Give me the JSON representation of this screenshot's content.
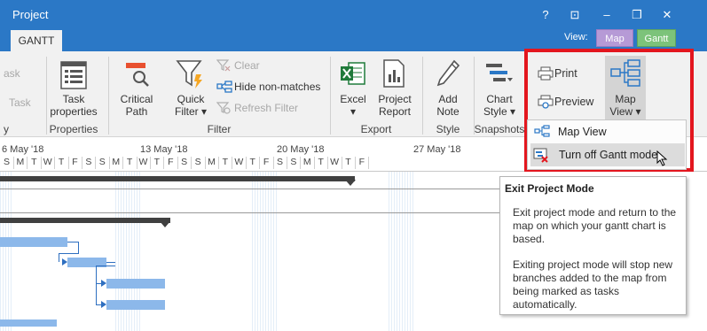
{
  "window": {
    "tab_project": "Project",
    "tab_gantt": "GANTT",
    "help": "?",
    "restore_ribbon": "⊡",
    "minimize": "–",
    "maximize": "❐",
    "close": "✕",
    "view_label": "View:",
    "view_map": "Map",
    "view_gantt": "Gantt"
  },
  "ribbon": {
    "partial_ask": "ask",
    "partial_task": "Task",
    "partial_y": "y",
    "task_properties": [
      "Task",
      "properties"
    ],
    "critical_path": [
      "Critical",
      "Path"
    ],
    "quick_filter": [
      "Quick",
      "Filter ▾"
    ],
    "clear": "Clear",
    "hide_non_matches": "Hide non-matches",
    "refresh_filter": "Refresh Filter",
    "excel": [
      "Excel",
      "▾"
    ],
    "project_report": [
      "Project",
      "Report"
    ],
    "add_note": [
      "Add",
      "Note"
    ],
    "chart_style": [
      "Chart",
      "Style ▾"
    ],
    "print": "Print",
    "preview": "Preview",
    "map_view": [
      "Map",
      "View ▾"
    ],
    "groups": {
      "properties": "Properties",
      "filter": "Filter",
      "export": "Export",
      "style": "Style",
      "snapshots": "Snapshots"
    }
  },
  "timeline": {
    "weeks": [
      "6 May '18",
      "13 May '18",
      "20 May '18",
      "27 May '18"
    ],
    "days": [
      "S",
      "M",
      "T",
      "W",
      "T",
      "F",
      "S",
      "S",
      "M",
      "T",
      "W",
      "T",
      "F",
      "S",
      "S",
      "M",
      "T",
      "W",
      "T",
      "F",
      "S",
      "S",
      "M",
      "T",
      "W",
      "T",
      "F"
    ]
  },
  "dropdown": {
    "map_view": "Map View",
    "turn_off": "Turn off Gantt mode"
  },
  "tooltip": {
    "title": "Exit Project Mode",
    "p1": "Exit project mode and return to the map on which your gantt chart is based.",
    "p2": "Exiting project mode will stop new branches added to the map from being marked as tasks automatically."
  },
  "colors": {
    "title_blue": "#2b78c6",
    "highlight_red": "#e3161e",
    "map_purple": "#b69ad6",
    "gantt_green": "#7cc37a",
    "task_blue": "#8cb8ea"
  }
}
